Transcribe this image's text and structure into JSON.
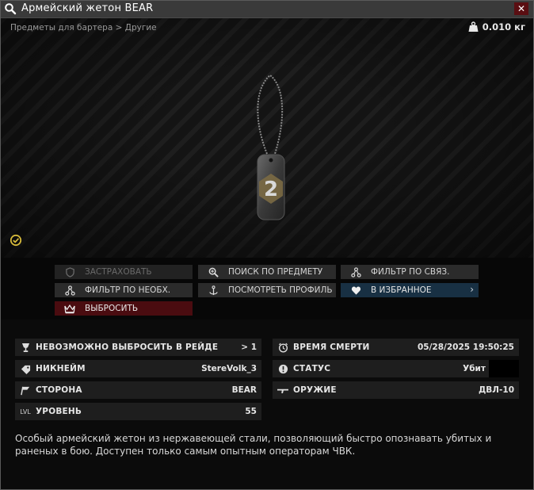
{
  "window": {
    "title": "Армейский жетон BEAR",
    "close_label": "✕"
  },
  "preview": {
    "breadcrumb": "Предметы для бартера > Другие",
    "weight": "0.010 кг"
  },
  "actions": {
    "insure": "ЗАСТРАХОВАТЬ",
    "search_item": "ПОИСК ПО ПРЕДМЕТУ",
    "filter_linked": "ФИЛЬТР ПО СВЯЗ.",
    "filter_needed": "ФИЛЬТР ПО НЕОБХ.",
    "view_profile": "ПОСМОТРЕТЬ ПРОФИЛЬ",
    "favorites": "В ИЗБРАННОЕ",
    "discard": "ВЫБРОСИТЬ"
  },
  "stats": {
    "left": [
      {
        "label": "НЕВОЗМОЖНО ВЫБРОСИТЬ В РЕЙДЕ",
        "value": "> 1",
        "icon": "goblet-icon"
      },
      {
        "label": "НИКНЕЙМ",
        "value": "StereVolk_3",
        "icon": "tag-icon"
      },
      {
        "label": "СТОРОНА",
        "value": "BEAR",
        "icon": "flag-icon"
      },
      {
        "label": "УРОВЕНЬ",
        "value": "55",
        "icon": "LVL"
      }
    ],
    "right": [
      {
        "label": "ВРЕМЯ СМЕРТИ",
        "value": "05/28/2025 19:50:25",
        "icon": "clock-icon"
      },
      {
        "label": "СТАТУС",
        "value": "Убит",
        "icon": "alert-icon"
      },
      {
        "label": "ОРУЖИЕ",
        "value": "ДВЛ-10",
        "icon": "rifle-icon"
      }
    ]
  },
  "description": "Особый армейский жетон из нержавеющей стали, позволяющий быстро опознавать убитых и раненых в бою. Доступен только самым опытным операторам ЧВК."
}
